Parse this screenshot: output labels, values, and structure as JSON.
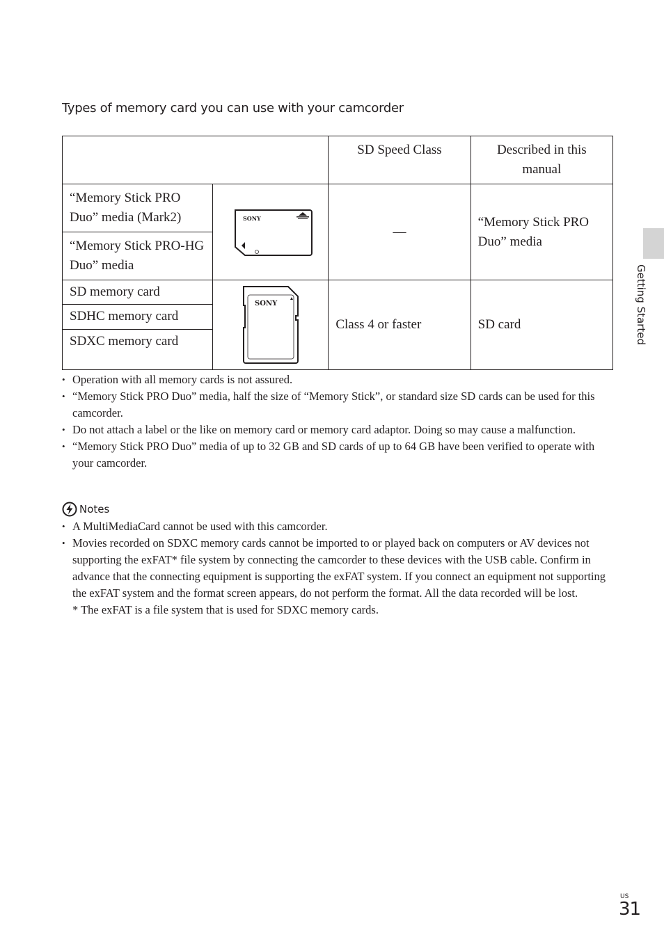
{
  "heading": "Types of memory card you can use with your camcorder",
  "table": {
    "headers": [
      "",
      "SD Speed Class",
      "Described in this manual"
    ],
    "groups": [
      {
        "types": [
          "“Memory Stick PRO Duo” media (Mark2)",
          "“Memory Stick PRO-HG Duo” media"
        ],
        "image": "memory-stick-pro-duo-illustration",
        "image_brand": "SONY",
        "speed_class": "—",
        "described_as": "“Memory Stick PRO Duo” media"
      },
      {
        "types": [
          "SD memory card",
          "SDHC memory card",
          "SDXC memory card"
        ],
        "image": "sd-card-illustration",
        "image_brand": "SONY",
        "speed_class": "Class 4 or faster",
        "described_as": "SD card"
      }
    ]
  },
  "bullets": [
    "Operation with all memory cards is not assured.",
    "“Memory Stick PRO Duo” media, half the size of “Memory Stick”, or standard size SD cards can be used for this camcorder.",
    "Do not attach a label or the like on memory card or memory card adaptor. Doing so may cause a malfunction.",
    "“Memory Stick PRO Duo” media of up to 32 GB and SD cards of up to 64 GB have been verified to operate with your camcorder."
  ],
  "notes": {
    "title": "Notes",
    "icon": "notes-warning-icon",
    "items": [
      "A MultiMediaCard cannot be used with this camcorder.",
      "Movies recorded on SDXC memory cards cannot be imported to or played back on computers or AV devices not supporting the exFAT* file system by connecting the camcorder to these devices with the USB cable. Confirm in advance that the connecting equipment is supporting the exFAT system. If you connect an equipment not supporting the exFAT system and the format screen appears, do not perform the format. All the data recorded will be lost."
    ],
    "footnote": "* The exFAT is a file system that is used for SDXC memory cards."
  },
  "side_tab": "Getting Started",
  "page": {
    "region": "US",
    "number": "31"
  }
}
